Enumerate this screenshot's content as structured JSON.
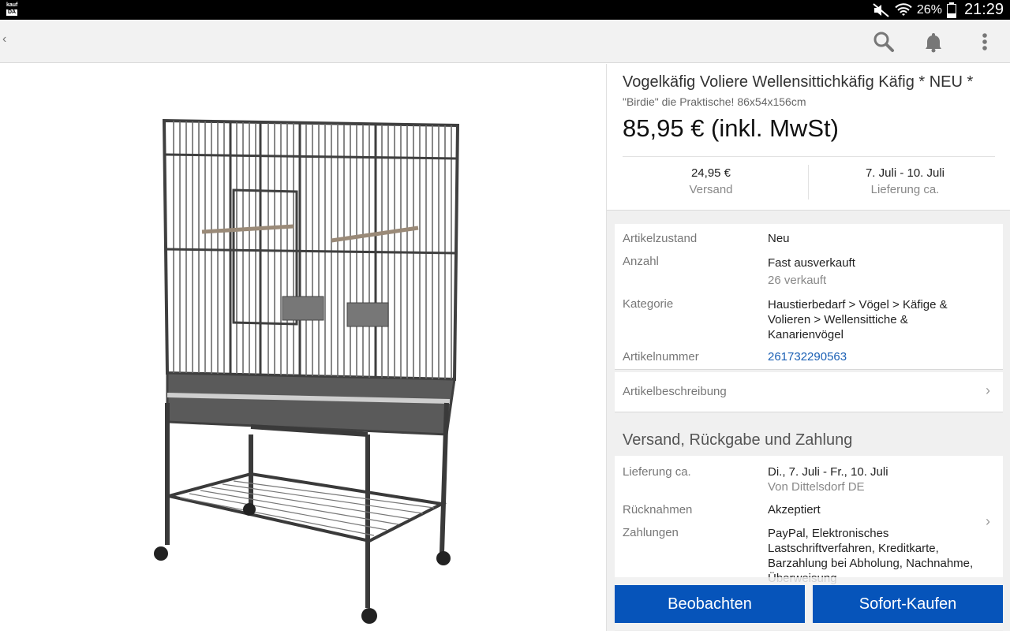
{
  "status_bar": {
    "logo_line1": "kauf",
    "logo_line2": "DA",
    "battery": "26%",
    "time": "21:29"
  },
  "appbar": {
    "back_label": "‹"
  },
  "listing": {
    "title": "Vogelkäfig Voliere Wellensittichkäfig Käfig * NEU *",
    "subtitle": "\"Birdie\" die Praktische! 86x54x156cm",
    "price": "85,95 € (inkl. MwSt)",
    "shipping_value": "24,95 €",
    "shipping_label": "Versand",
    "delivery_value": "7. Juli - 10. Juli",
    "delivery_label": "Lieferung ca."
  },
  "details": {
    "condition_label": "Artikelzustand",
    "condition_value": "Neu",
    "quantity_label": "Anzahl",
    "quantity_value": "Fast ausverkauft",
    "quantity_sub": "26 verkauft",
    "category_label": "Kategorie",
    "category_value": [
      "Haustierbedarf > Vögel > Käfige &",
      "Volieren > Wellensittiche &",
      "Kanarienvögel"
    ],
    "itemnumber_label": "Artikelnummer",
    "itemnumber_value": "261732290563"
  },
  "description": {
    "label": "Artikelbeschreibung"
  },
  "shipping_section": {
    "title": "Versand, Rückgabe und Zahlung",
    "delivery_label": "Lieferung ca.",
    "delivery_value": "Di., 7. Juli - Fr., 10. Juli",
    "delivery_from": "Von Dittelsdorf DE",
    "returns_label": "Rücknahmen",
    "returns_value": "Akzeptiert",
    "payments_label": "Zahlungen",
    "payments_value": [
      "PayPal, Elektronisches",
      "Lastschriftverfahren, Kreditkarte,",
      "Barzahlung bei Abholung, Nachnahme,",
      "Überweisung"
    ]
  },
  "actions": {
    "watch_label": "Beobachten",
    "buy_label": "Sofort-Kaufen"
  },
  "colors": {
    "accent": "#0654ba",
    "link": "#1a5fb4"
  }
}
